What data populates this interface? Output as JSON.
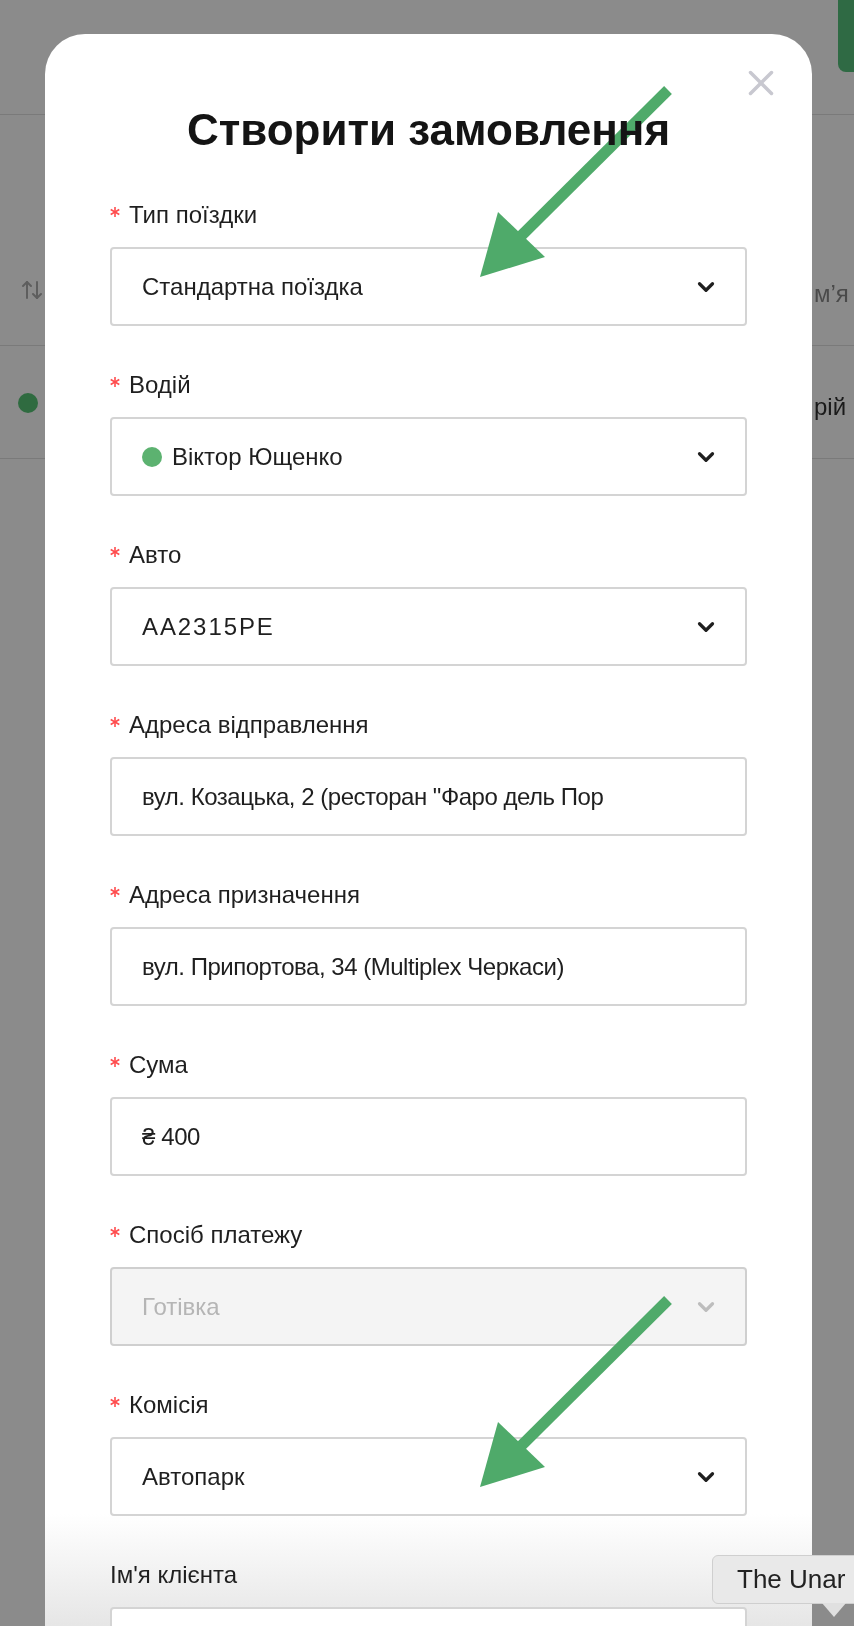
{
  "background_table": {
    "header_cell": "м’я",
    "rows": [
      {
        "color": "#2f6b40",
        "cell": "рій"
      }
    ]
  },
  "dialog": {
    "title": "Створити замовлення",
    "fields": [
      {
        "kind": "select",
        "label": "Тип поїздки",
        "required": true,
        "value": "Стандартна поїздка",
        "disabled": false
      },
      {
        "kind": "select",
        "label": "Водій",
        "required": true,
        "value": "Віктор Ющенко",
        "color": "#5cb270",
        "disabled": false
      },
      {
        "kind": "select",
        "label": "Авто",
        "required": true,
        "value": "AA2315PE",
        "disabled": false
      },
      {
        "kind": "input",
        "label": "Адреса відправлення",
        "required": true,
        "value": "вул. Козацька, 2 (ресторан \"Фаро дель Пор"
      },
      {
        "kind": "input",
        "label": "Адреса призначення",
        "required": true,
        "value": "вул. Припортова, 34 (Multiplex Черкаси)"
      },
      {
        "kind": "input",
        "label": "Сума",
        "required": true,
        "prefix": "₴",
        "value": "400"
      },
      {
        "kind": "select",
        "label": "Спосіб платежу",
        "required": true,
        "value": "Готівка",
        "disabled": true
      },
      {
        "kind": "select",
        "label": "Комісія",
        "required": true,
        "value": "Автопарк",
        "disabled": false
      },
      {
        "kind": "input",
        "label": "Ім'я клієнта",
        "required": false
      }
    ]
  },
  "tooltip": {
    "text": "The Unar"
  }
}
